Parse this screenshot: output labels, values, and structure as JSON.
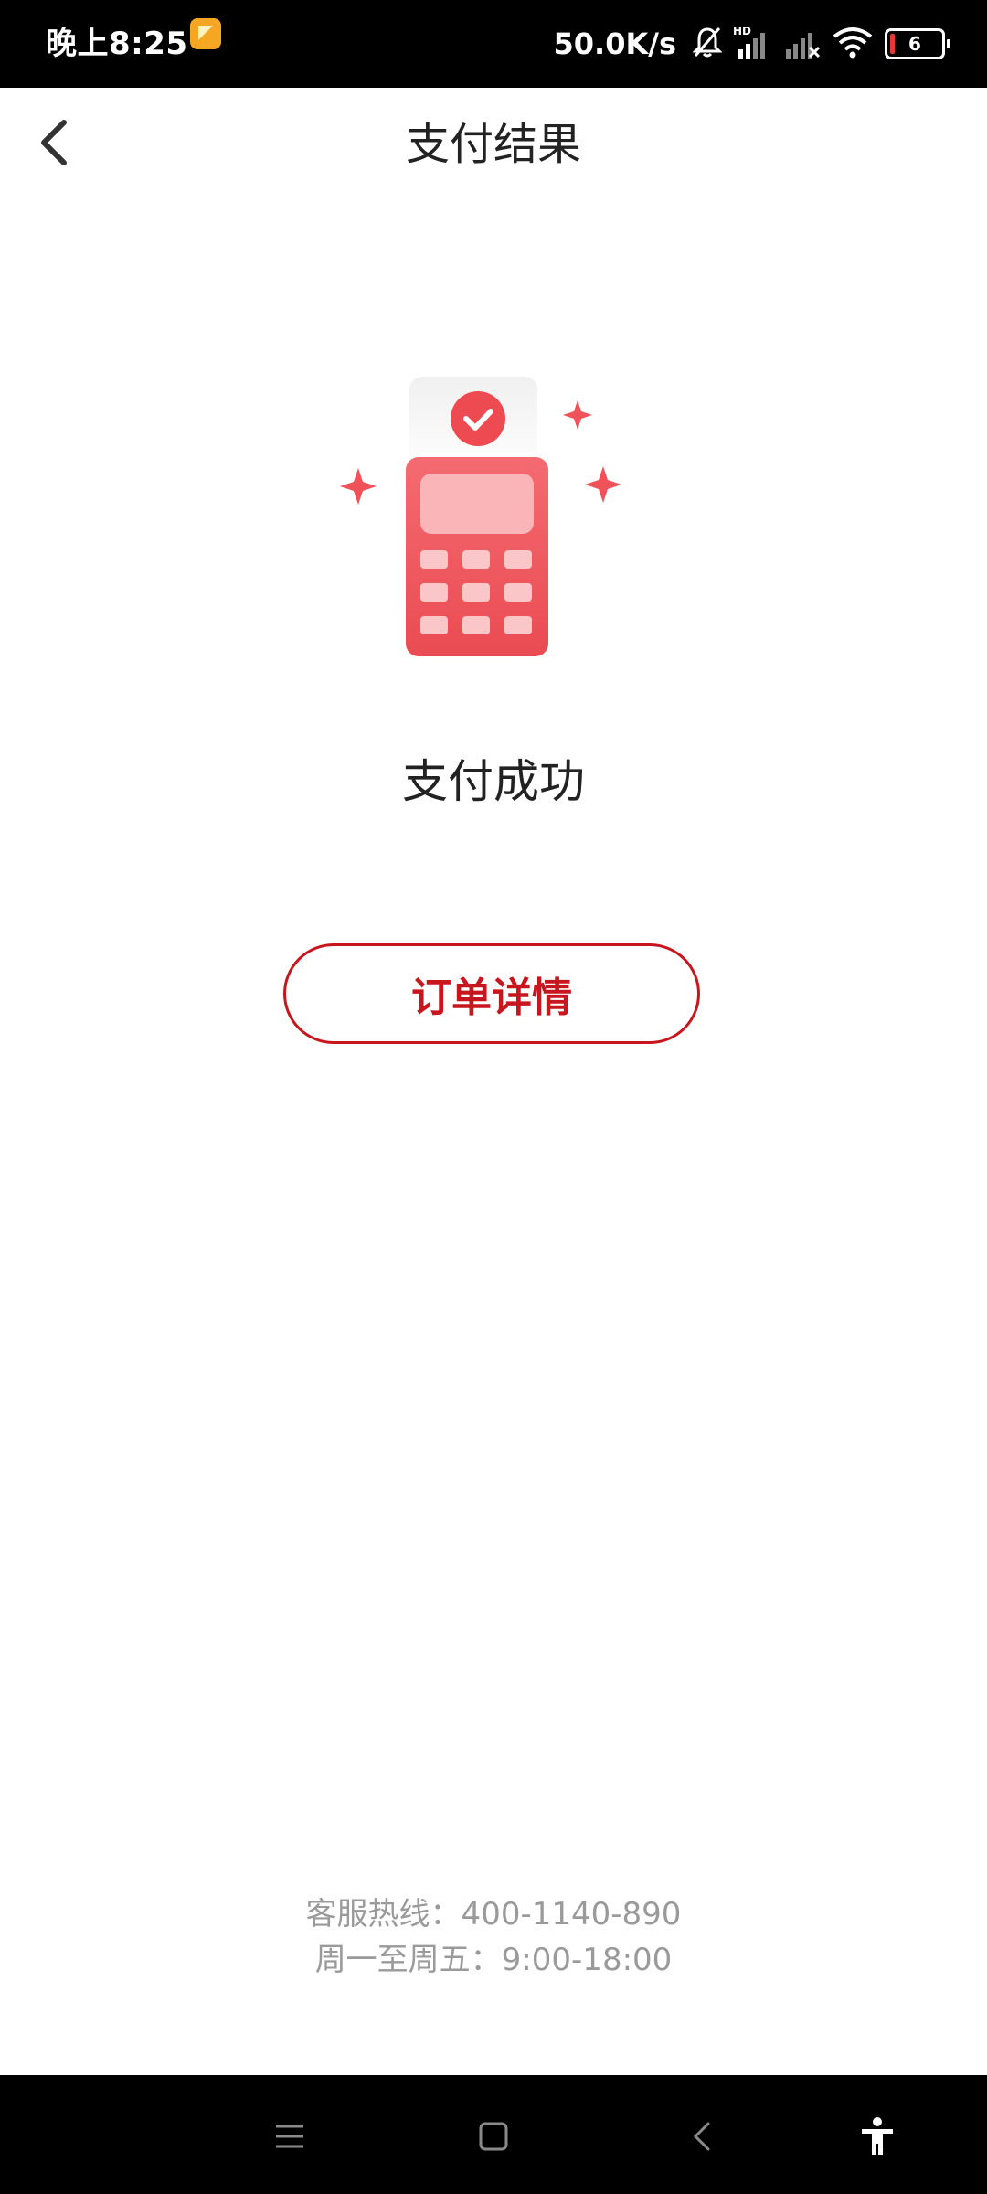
{
  "status_bar": {
    "time": "晚上8:25",
    "net_speed": "50.0K/s",
    "battery_level": "6",
    "icons": [
      "app-notification-icon",
      "mute-bell-icon",
      "hd-signal-icon",
      "signal-icon",
      "wifi-icon",
      "battery-icon"
    ]
  },
  "header": {
    "title": "支付结果",
    "back_icon": "back-arrow-icon"
  },
  "result": {
    "status_text": "支付成功",
    "illustration": "pos-terminal-success-icon"
  },
  "actions": {
    "order_detail_label": "订单详情"
  },
  "footer": {
    "hotline": "客服热线：400-1140-890",
    "hours": "周一至周五：9:00-18:00"
  },
  "nav_bar": {
    "icons": [
      "menu-icon",
      "home-icon",
      "back-icon",
      "accessibility-icon"
    ]
  },
  "colors": {
    "accent": "#c8161e",
    "illustration_red": "#f0525a",
    "text_primary": "#222222",
    "text_secondary": "#9a9a9a"
  }
}
